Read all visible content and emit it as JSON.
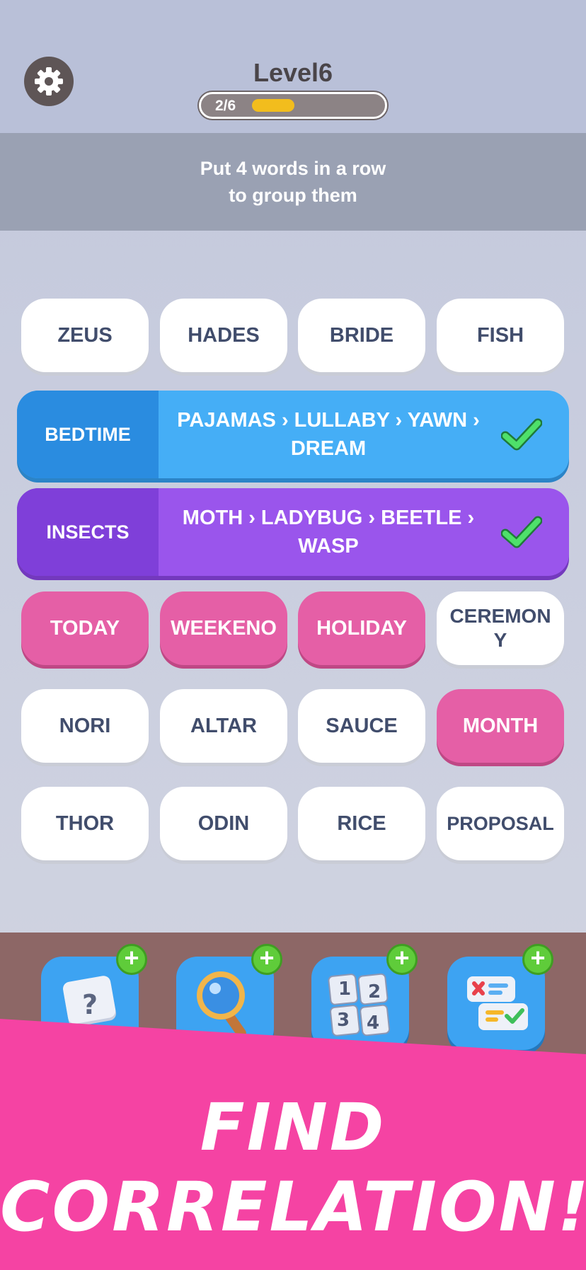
{
  "header": {
    "level_title": "Level6",
    "progress_text": "2/6",
    "progress_fraction": 0.333
  },
  "instruction": {
    "line1": "Put 4 words in a row",
    "line2": "to group them"
  },
  "board": {
    "row1": [
      "ZEUS",
      "HADES",
      "BRIDE",
      "FISH"
    ],
    "solved_groups": [
      {
        "category": "BEDTIME",
        "words_line1": "PAJAMAS › LULLABY › YAWN ›",
        "words_line2": "DREAM",
        "color": "#45aef6"
      },
      {
        "category": "INSECTS",
        "words_line1": "MOTH › LADYBUG › BEETLE ›",
        "words_line2": "WASP",
        "color": "#9a55ec"
      }
    ],
    "row4": [
      "TODAY",
      "WEEKENO",
      "HOLIDAY",
      "CEREMON\nY"
    ],
    "row5": [
      "NORI",
      "ALTAR",
      "SAUCE",
      "MONTH"
    ],
    "row6": [
      "THOR",
      "ODIN",
      "RICE",
      "PROPOSAL"
    ],
    "selected_color": "#e55fa6"
  },
  "boosters": {
    "hint_glyph": "?",
    "shuffle_numbers": [
      "1",
      "2",
      "3",
      "4"
    ],
    "plus_glyph": "+"
  },
  "banner": {
    "line1": "FIND",
    "line2": "CORRELATION!"
  }
}
